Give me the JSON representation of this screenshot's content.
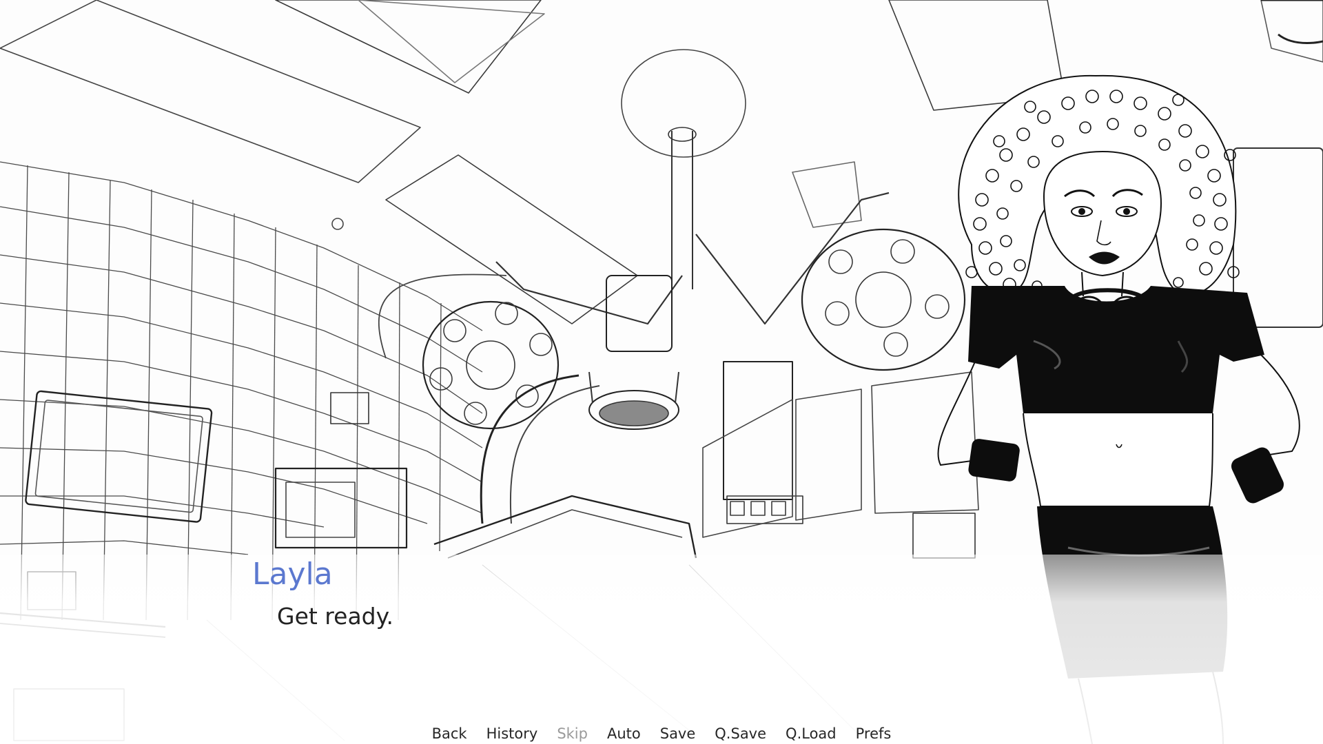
{
  "scene": {
    "background": "operating-room-sketch",
    "character": "layla-sprite"
  },
  "dialogue": {
    "speaker": "Layla",
    "speaker_color": "#5b78cf",
    "text": "Get ready."
  },
  "quick_menu": {
    "items": [
      {
        "label": "Back",
        "enabled": true
      },
      {
        "label": "History",
        "enabled": true
      },
      {
        "label": "Skip",
        "enabled": false
      },
      {
        "label": "Auto",
        "enabled": true
      },
      {
        "label": "Save",
        "enabled": true
      },
      {
        "label": "Q.Save",
        "enabled": true
      },
      {
        "label": "Q.Load",
        "enabled": true
      },
      {
        "label": "Prefs",
        "enabled": true
      }
    ]
  }
}
